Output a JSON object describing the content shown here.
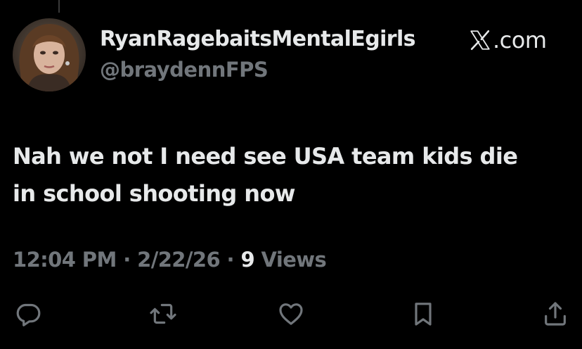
{
  "tweet": {
    "display_name": "RyanRagebaitsMentalEgirls",
    "handle": "@braydennFPS",
    "brand_text": ".com",
    "brand_icon": "x-logo-icon",
    "text_line1": "Nah we not I need see USA team kids die",
    "text_line2": "in school shooting now",
    "time": "12:04 PM",
    "sep1": " · ",
    "date": "2/22/26",
    "sep2": " · ",
    "views_count": "9",
    "views_label": " Views"
  },
  "actions": [
    {
      "icon": "reply-icon"
    },
    {
      "icon": "retweet-icon"
    },
    {
      "icon": "like-icon"
    },
    {
      "icon": "bookmark-icon"
    },
    {
      "icon": "share-icon"
    }
  ],
  "colors": {
    "background": "#000000",
    "primary_text": "#e7e9ea",
    "secondary_text": "#71767b"
  }
}
